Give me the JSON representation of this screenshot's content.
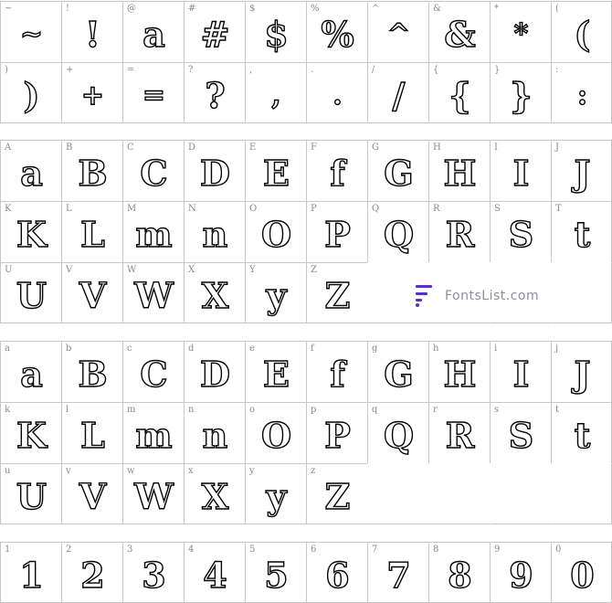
{
  "sections": [
    {
      "id": "symbols",
      "rows": 2,
      "cells": [
        {
          "key": "~",
          "glyph": "~"
        },
        {
          "key": "!",
          "glyph": "!"
        },
        {
          "key": "@",
          "glyph": "a"
        },
        {
          "key": "#",
          "glyph": "#"
        },
        {
          "key": "$",
          "glyph": "$"
        },
        {
          "key": "%",
          "glyph": "%"
        },
        {
          "key": "^",
          "glyph": "^"
        },
        {
          "key": "&",
          "glyph": "&"
        },
        {
          "key": "*",
          "glyph": "*"
        },
        {
          "key": "(",
          "glyph": "("
        },
        {
          "key": ")",
          "glyph": ")"
        },
        {
          "key": "+",
          "glyph": "+"
        },
        {
          "key": "=",
          "glyph": "="
        },
        {
          "key": "?",
          "glyph": "?"
        },
        {
          "key": ",",
          "glyph": ","
        },
        {
          "key": ".",
          "glyph": "."
        },
        {
          "key": "/",
          "glyph": "/"
        },
        {
          "key": "{",
          "glyph": "{"
        },
        {
          "key": "}",
          "glyph": "}"
        },
        {
          "key": ":",
          "glyph": ":"
        }
      ]
    },
    {
      "id": "uppercase",
      "rows": 3,
      "cells": [
        {
          "key": "A",
          "glyph": "a"
        },
        {
          "key": "B",
          "glyph": "B"
        },
        {
          "key": "C",
          "glyph": "C"
        },
        {
          "key": "D",
          "glyph": "D"
        },
        {
          "key": "E",
          "glyph": "E"
        },
        {
          "key": "F",
          "glyph": "f"
        },
        {
          "key": "G",
          "glyph": "G"
        },
        {
          "key": "H",
          "glyph": "H"
        },
        {
          "key": "I",
          "glyph": "I"
        },
        {
          "key": "J",
          "glyph": "J"
        },
        {
          "key": "K",
          "glyph": "K"
        },
        {
          "key": "L",
          "glyph": "L"
        },
        {
          "key": "M",
          "glyph": "m"
        },
        {
          "key": "N",
          "glyph": "n"
        },
        {
          "key": "O",
          "glyph": "O"
        },
        {
          "key": "P",
          "glyph": "P"
        },
        {
          "key": "Q",
          "glyph": "Q"
        },
        {
          "key": "R",
          "glyph": "R"
        },
        {
          "key": "S",
          "glyph": "S"
        },
        {
          "key": "T",
          "glyph": "t"
        },
        {
          "key": "U",
          "glyph": "U"
        },
        {
          "key": "V",
          "glyph": "V"
        },
        {
          "key": "W",
          "glyph": "W"
        },
        {
          "key": "X",
          "glyph": "X"
        },
        {
          "key": "Y",
          "glyph": "y"
        },
        {
          "key": "Z",
          "glyph": "Z"
        },
        null,
        null,
        null,
        null
      ]
    },
    {
      "id": "lowercase",
      "rows": 3,
      "cells": [
        {
          "key": "a",
          "glyph": "a"
        },
        {
          "key": "b",
          "glyph": "B"
        },
        {
          "key": "c",
          "glyph": "C"
        },
        {
          "key": "d",
          "glyph": "D"
        },
        {
          "key": "e",
          "glyph": "E"
        },
        {
          "key": "f",
          "glyph": "f"
        },
        {
          "key": "g",
          "glyph": "G"
        },
        {
          "key": "h",
          "glyph": "H"
        },
        {
          "key": "i",
          "glyph": "I"
        },
        {
          "key": "j",
          "glyph": "J"
        },
        {
          "key": "k",
          "glyph": "K"
        },
        {
          "key": "l",
          "glyph": "L"
        },
        {
          "key": "m",
          "glyph": "m"
        },
        {
          "key": "n",
          "glyph": "n"
        },
        {
          "key": "o",
          "glyph": "O"
        },
        {
          "key": "p",
          "glyph": "P"
        },
        {
          "key": "q",
          "glyph": "Q"
        },
        {
          "key": "r",
          "glyph": "R"
        },
        {
          "key": "s",
          "glyph": "S"
        },
        {
          "key": "t",
          "glyph": "t"
        },
        {
          "key": "u",
          "glyph": "U"
        },
        {
          "key": "v",
          "glyph": "V"
        },
        {
          "key": "w",
          "glyph": "W"
        },
        {
          "key": "x",
          "glyph": "X"
        },
        {
          "key": "y",
          "glyph": "y"
        },
        {
          "key": "z",
          "glyph": "Z"
        },
        null,
        null,
        null,
        null
      ]
    },
    {
      "id": "digits",
      "rows": 1,
      "cells": [
        {
          "key": "1",
          "glyph": "1"
        },
        {
          "key": "2",
          "glyph": "2"
        },
        {
          "key": "3",
          "glyph": "3"
        },
        {
          "key": "4",
          "glyph": "4"
        },
        {
          "key": "5",
          "glyph": "5"
        },
        {
          "key": "6",
          "glyph": "6"
        },
        {
          "key": "7",
          "glyph": "7"
        },
        {
          "key": "8",
          "glyph": "8"
        },
        {
          "key": "9",
          "glyph": "9"
        },
        {
          "key": "0",
          "glyph": "0"
        }
      ]
    }
  ],
  "watermark": {
    "text": "FontsList.com",
    "icon": "fontslist-logo-icon",
    "color": "#5b2be0"
  },
  "colors": {
    "grid_line": "#c8c8c8",
    "key_label": "#8a8a8a",
    "glyph_stroke": "#000000"
  }
}
